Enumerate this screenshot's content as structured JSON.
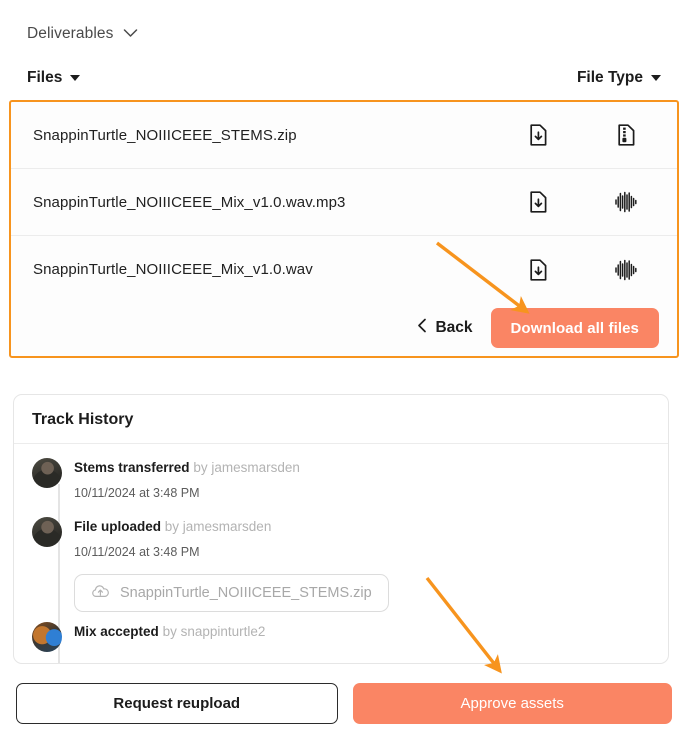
{
  "header": {
    "deliverables_label": "Deliverables",
    "deliverables_chevron_icon": "chevron-down-icon",
    "files_label": "Files",
    "files_sort_icon": "triangle-down-icon",
    "file_type_label": "File Type",
    "file_type_sort_icon": "triangle-down-icon"
  },
  "files_panel": {
    "highlight_color": "#F7941E",
    "rows": [
      {
        "name": "SnappinTurtle_NOIIICEEE_STEMS.zip",
        "download_icon": "file-download-icon",
        "type_icon": "archive-file-icon"
      },
      {
        "name": "SnappinTurtle_NOIIICEEE_Mix_v1.0.wav.mp3",
        "download_icon": "file-download-icon",
        "type_icon": "audio-waveform-icon"
      },
      {
        "name": "SnappinTurtle_NOIIICEEE_Mix_v1.0.wav",
        "download_icon": "file-download-icon",
        "type_icon": "audio-waveform-icon"
      }
    ],
    "back_label": "Back",
    "back_icon": "chevron-left-icon",
    "download_all_label": "Download all files",
    "download_all_color": "#FA8564"
  },
  "track_history": {
    "title": "Track History",
    "entries": [
      {
        "action": "Stems transferred",
        "by": "by jamesmarsden",
        "timestamp": "10/11/2024 at 3:48 PM",
        "avatar": "avatar-jamesmarsden"
      },
      {
        "action": "File uploaded",
        "by": "by jamesmarsden",
        "timestamp": "10/11/2024 at 3:48 PM",
        "avatar": "avatar-jamesmarsden",
        "attachment": "SnappinTurtle_NOIIICEEE_STEMS.zip",
        "attachment_icon": "cloud-upload-icon"
      },
      {
        "action": "Mix accepted",
        "by": "by snappinturtle2",
        "avatar": "avatar-snappinturtle2"
      }
    ]
  },
  "bottom_bar": {
    "request_reupload_label": "Request reupload",
    "approve_assets_label": "Approve assets",
    "approve_color": "#FA8564"
  },
  "annotations": {
    "arrow_color": "#F7941E",
    "arrow_1_target": "download-all-files-button",
    "arrow_2_target": "approve-assets-button"
  }
}
